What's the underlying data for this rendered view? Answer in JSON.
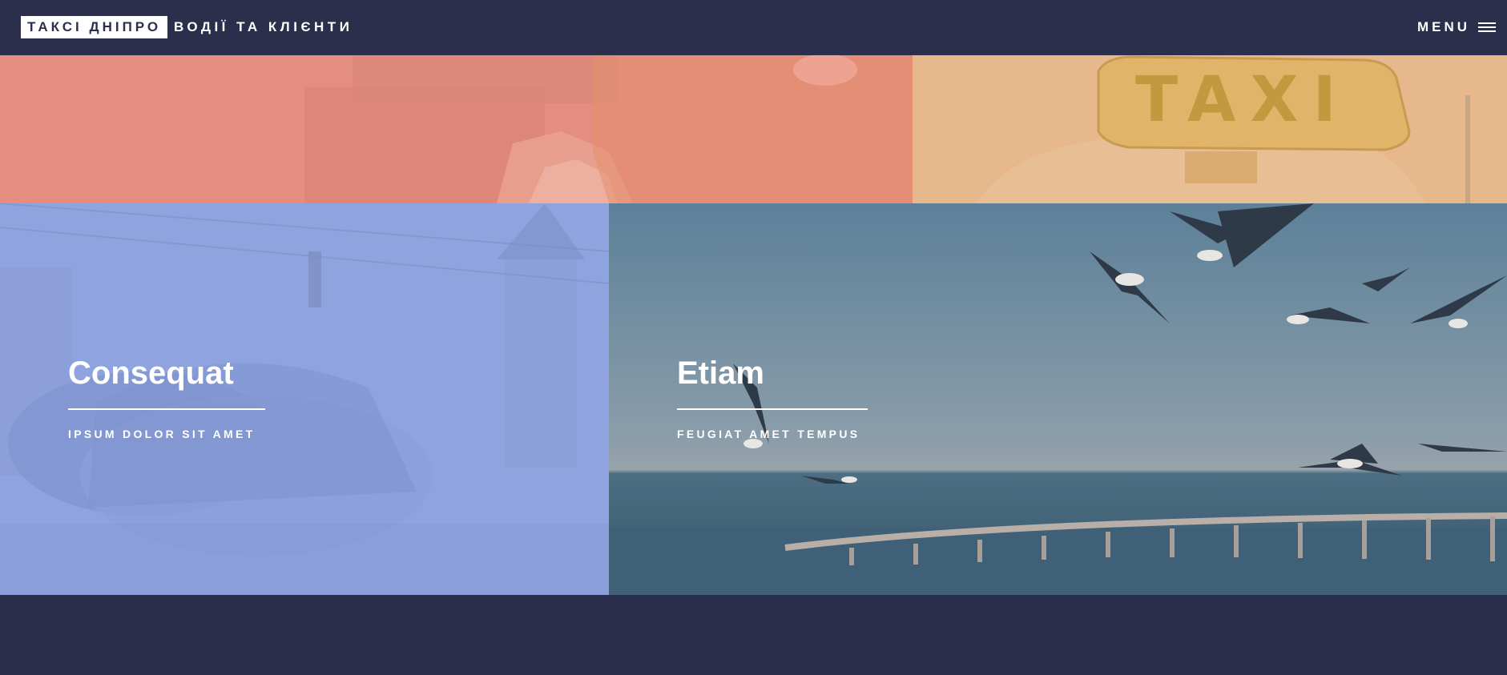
{
  "header": {
    "logo": "ТАКСІ ДНІПРО",
    "tagline": "ВОДІЇ ТА КЛІЄНТИ",
    "menu_label": "MENU",
    "menu_icon": "hamburger-icon"
  },
  "tiles": [
    {
      "title": "",
      "subtitle": "",
      "color": "#e58d80"
    },
    {
      "title": "",
      "subtitle": "",
      "sign_text": "TAXI",
      "color": "#e6b88b"
    },
    {
      "title": "Consequat",
      "subtitle": "IPSUM DOLOR SIT AMET",
      "color": "#8fa4df"
    },
    {
      "title": "Etiam",
      "subtitle": "FEUGIAT AMET TEMPUS",
      "color": "#5d7f97"
    }
  ],
  "colors": {
    "header_bg": "#2b2f4c",
    "page_bg": "#2a2e4a"
  }
}
